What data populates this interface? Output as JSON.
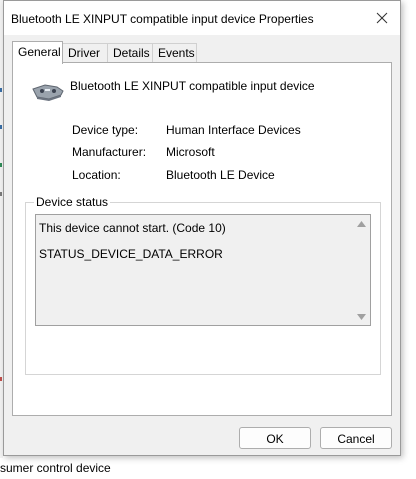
{
  "background": {
    "bottom_text": "sumer control device"
  },
  "dialog": {
    "title": "Bluetooth LE XINPUT compatible input device Properties",
    "tabs": [
      {
        "label": "General",
        "active": true
      },
      {
        "label": "Driver",
        "active": false
      },
      {
        "label": "Details",
        "active": false
      },
      {
        "label": "Events",
        "active": false
      }
    ],
    "device_name": "Bluetooth LE XINPUT compatible input device",
    "properties": [
      {
        "label": "Device type:",
        "value": "Human Interface Devices"
      },
      {
        "label": "Manufacturer:",
        "value": "Microsoft"
      },
      {
        "label": "Location:",
        "value": "Bluetooth LE Device"
      }
    ],
    "device_status": {
      "legend": "Device status",
      "lines": [
        "This device cannot start. (Code 10)",
        "STATUS_DEVICE_DATA_ERROR"
      ]
    },
    "buttons": {
      "ok": "OK",
      "cancel": "Cancel"
    }
  },
  "icons": {
    "close": "close-icon",
    "device": "gamepad-device-icon",
    "scroll_up": "scroll-up-arrow-icon",
    "scroll_down": "scroll-down-arrow-icon"
  }
}
